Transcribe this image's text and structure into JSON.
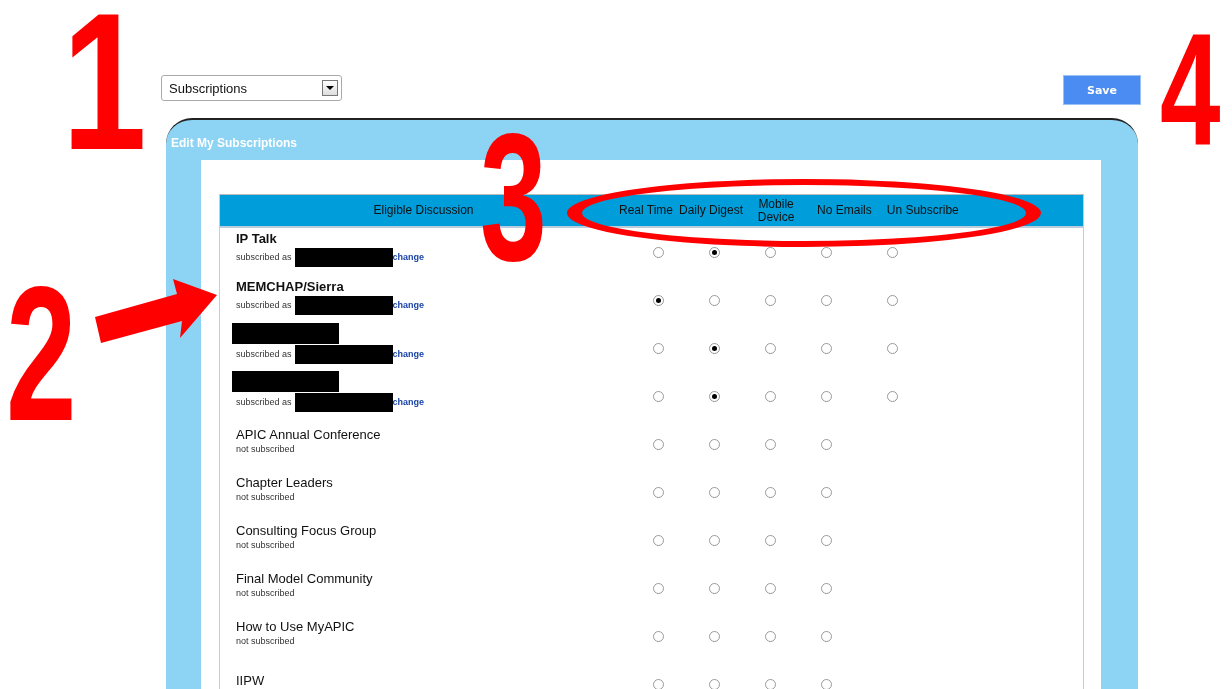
{
  "view_select": {
    "value": "Subscriptions"
  },
  "save_button": {
    "label": "Save"
  },
  "panel": {
    "title": "Edit My Subscriptions"
  },
  "table": {
    "columns": [
      "Eligible Discussion",
      "Real Time",
      "Daily Digest",
      "Mobile Device",
      "No Emails",
      "Un Subscribe"
    ],
    "rows": [
      {
        "kind": "subscribed",
        "name": "IP Talk",
        "name_redacted": false,
        "status": "subscribed as",
        "user_redacted": true,
        "link": "change",
        "choices": [
          {
            "selected": false
          },
          {
            "selected": true
          },
          {
            "selected": false
          },
          {
            "selected": false
          },
          {
            "selected": false
          }
        ]
      },
      {
        "kind": "subscribed",
        "name": "MEMCHAP/Sierra",
        "name_redacted": false,
        "status": "subscribed as",
        "user_redacted": true,
        "link": "change",
        "choices": [
          {
            "selected": true
          },
          {
            "selected": false
          },
          {
            "selected": false
          },
          {
            "selected": false
          },
          {
            "selected": false
          }
        ]
      },
      {
        "kind": "subscribed",
        "name_redacted": true,
        "status": "subscribed as",
        "user_redacted": true,
        "link": "change",
        "choices": [
          {
            "selected": false
          },
          {
            "selected": true
          },
          {
            "selected": false
          },
          {
            "selected": false
          },
          {
            "selected": false
          }
        ]
      },
      {
        "kind": "subscribed",
        "name_redacted": true,
        "status": "subscribed as",
        "user_redacted": true,
        "link": "change",
        "choices": [
          {
            "selected": false
          },
          {
            "selected": true
          },
          {
            "selected": false
          },
          {
            "selected": false
          },
          {
            "selected": false
          }
        ]
      },
      {
        "kind": "not_subscribed",
        "name": "APIC Annual Conference",
        "status": "not subscribed",
        "choices": [
          {
            "selected": false
          },
          {
            "selected": false
          },
          {
            "selected": false
          },
          {
            "selected": false
          }
        ]
      },
      {
        "kind": "not_subscribed",
        "name": "Chapter Leaders",
        "status": "not subscribed",
        "choices": [
          {
            "selected": false
          },
          {
            "selected": false
          },
          {
            "selected": false
          },
          {
            "selected": false
          }
        ]
      },
      {
        "kind": "not_subscribed",
        "name": "Consulting Focus Group",
        "status": "not subscribed",
        "choices": [
          {
            "selected": false
          },
          {
            "selected": false
          },
          {
            "selected": false
          },
          {
            "selected": false
          }
        ]
      },
      {
        "kind": "not_subscribed",
        "name": "Final Model Community",
        "status": "not subscribed",
        "choices": [
          {
            "selected": false
          },
          {
            "selected": false
          },
          {
            "selected": false
          },
          {
            "selected": false
          }
        ]
      },
      {
        "kind": "not_subscribed",
        "name": "How to Use MyAPIC",
        "status": "not subscribed",
        "choices": [
          {
            "selected": false
          },
          {
            "selected": false
          },
          {
            "selected": false
          },
          {
            "selected": false
          }
        ]
      },
      {
        "kind": "not_subscribed",
        "name": "IIPW",
        "choices": [
          {
            "selected": false
          },
          {
            "selected": false
          },
          {
            "selected": false
          },
          {
            "selected": false
          }
        ]
      }
    ]
  },
  "annotations": [
    {
      "kind": "number",
      "label": "1"
    },
    {
      "kind": "number",
      "label": "2"
    },
    {
      "kind": "arrow"
    },
    {
      "kind": "number",
      "label": "3"
    },
    {
      "kind": "ellipse"
    },
    {
      "kind": "number",
      "label": "4"
    }
  ]
}
